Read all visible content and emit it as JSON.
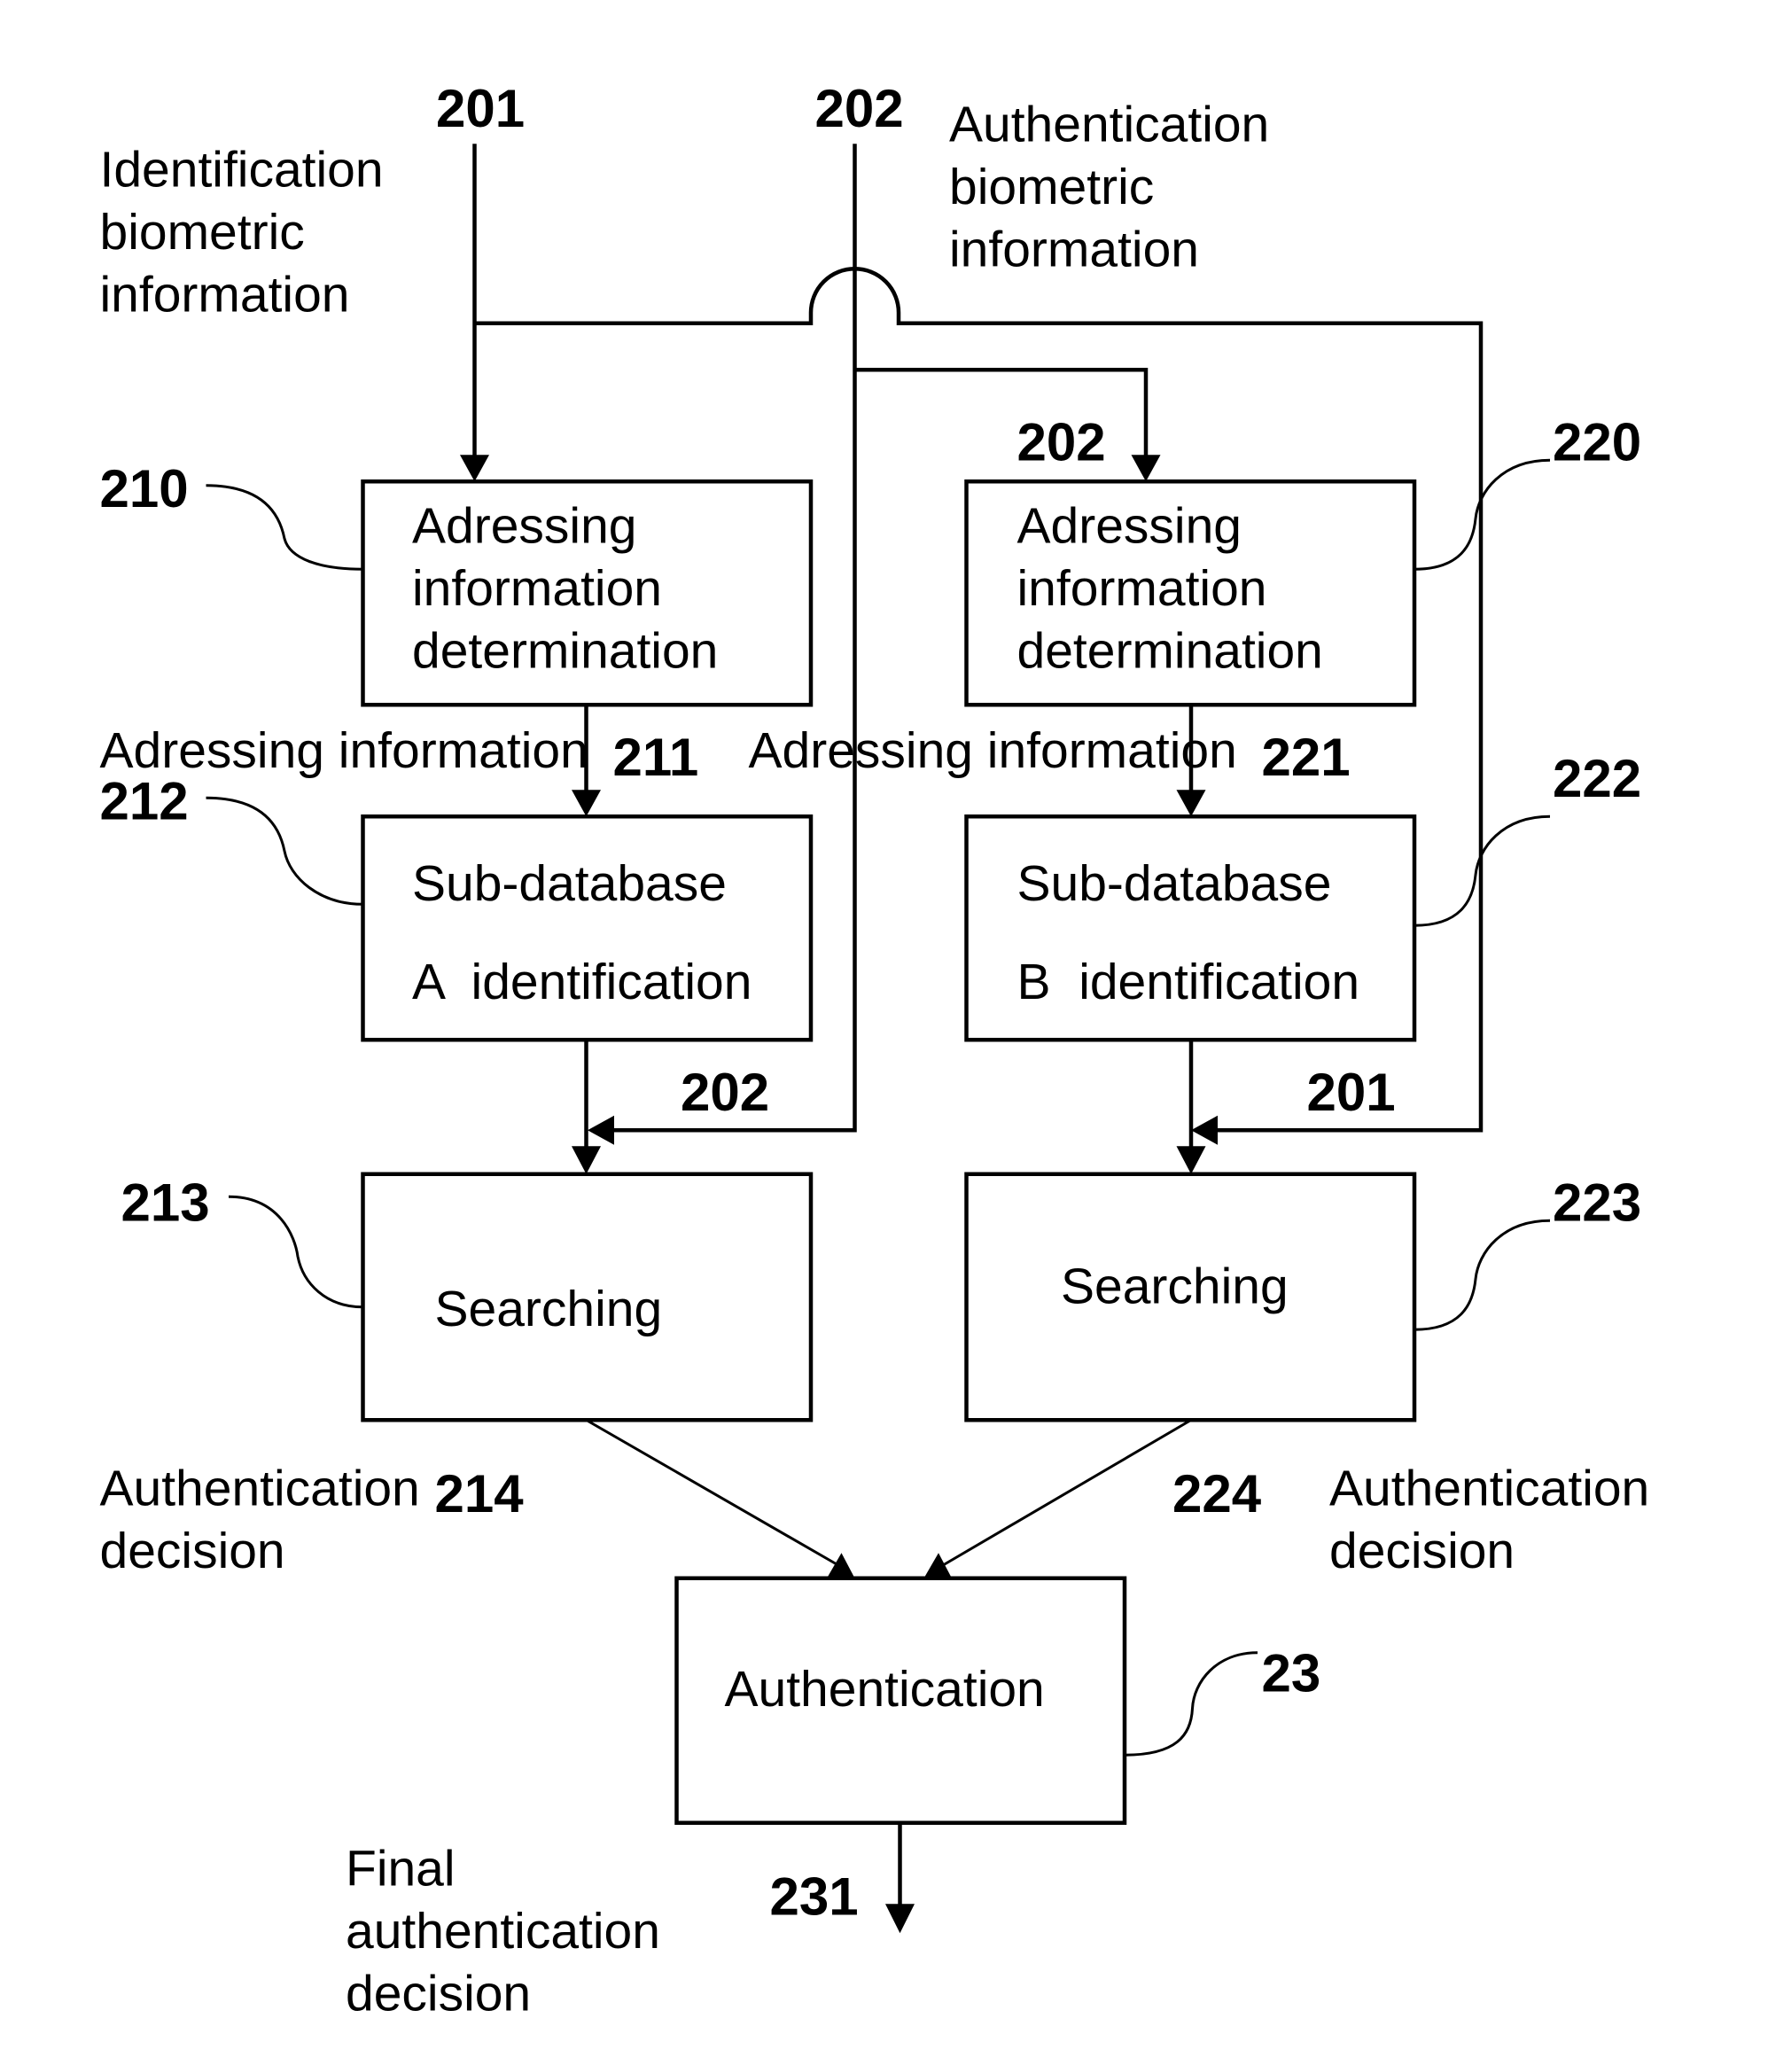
{
  "diagram": {
    "inputs": {
      "identification": {
        "ref": "201",
        "label_lines": [
          "Identification",
          "biometric",
          "information"
        ]
      },
      "authentication": {
        "ref": "202",
        "label_lines": [
          "Authentication",
          "biometric",
          "information"
        ]
      }
    },
    "left_branch": {
      "addressing_box": {
        "ref": "210",
        "lines": [
          "Adressing",
          "information",
          "determination"
        ]
      },
      "addressing_output": {
        "ref": "211",
        "label": "Adressing information"
      },
      "subdb_box": {
        "ref": "212",
        "lines": [
          "Sub-database",
          "A  identification"
        ]
      },
      "search_input_ref": "202",
      "search_box": {
        "ref": "213",
        "lines": [
          "Searching"
        ]
      },
      "decision": {
        "ref": "214",
        "label_lines": [
          "Authentication",
          "decision"
        ]
      }
    },
    "right_branch": {
      "input_ref": "202",
      "addressing_box": {
        "ref": "220",
        "lines": [
          "Adressing",
          "information",
          "determination"
        ]
      },
      "addressing_output": {
        "ref": "221",
        "label": "Adressing information"
      },
      "subdb_box": {
        "ref": "222",
        "lines": [
          "Sub-database",
          "B  identification"
        ]
      },
      "search_input_ref": "201",
      "search_box": {
        "ref": "223",
        "lines": [
          "Searching"
        ]
      },
      "decision": {
        "ref": "224",
        "label_lines": [
          "Authentication",
          "decision"
        ]
      }
    },
    "final": {
      "auth_box": {
        "ref": "23",
        "lines": [
          "Authentication"
        ]
      },
      "output": {
        "ref": "231",
        "label_lines": [
          "Final",
          "authentication",
          "decision"
        ]
      }
    }
  }
}
